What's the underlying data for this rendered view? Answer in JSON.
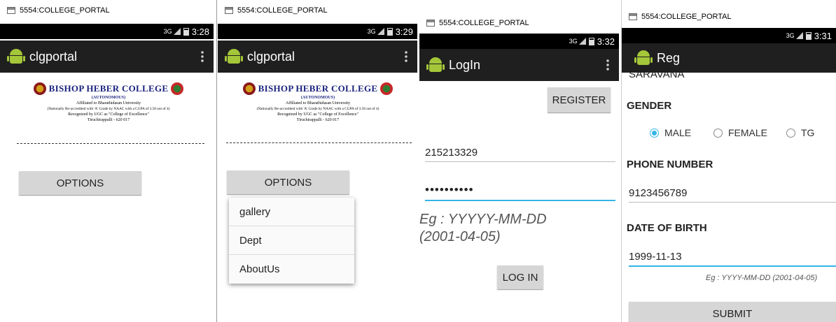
{
  "screens": [
    {
      "window_title": "5554:COLLEGE_PORTAL",
      "network": "3G",
      "time": "3:28",
      "app_title": "clgportal",
      "header": {
        "college_name": "BISHOP HEBER COLLEGE",
        "autonomous": "(AUTONOMOUS)",
        "affiliation": "Affiliated to Bharathidasan University",
        "accreditation": "(Nationally Re-accredited with 'A' Grade by NAAC with a CGPA of 3.58 out of 4)",
        "recognition": "Recognized by UGC as \"College of Excellence\"",
        "address": "Tiruchirappalli - 620 017"
      },
      "options_button": "OPTIONS"
    },
    {
      "window_title": "5554:COLLEGE_PORTAL",
      "network": "3G",
      "time": "3:29",
      "app_title": "clgportal",
      "header": {
        "college_name": "BISHOP HEBER COLLEGE",
        "autonomous": "(AUTONOMOUS)",
        "affiliation": "Affiliated to Bharathidasan University",
        "accreditation": "(Nationally Re-accredited with 'A' Grade by NAAC with a CGPA of 3.58 out of 4)",
        "recognition": "Recognized by UGC as \"College of Excellence\"",
        "address": "Tiruchirappalli - 620 017"
      },
      "options_button": "OPTIONS",
      "menu": [
        "gallery",
        "Dept",
        "AboutUs"
      ]
    },
    {
      "window_title": "5554:COLLEGE_PORTAL",
      "network": "3G",
      "time": "3:32",
      "app_title": "LogIn",
      "register_button": "REGISTER",
      "username_value": "215213329",
      "password_value": "••••••••••",
      "date_hint": "Eg : YYYYY-MM-DD (2001-04-05)",
      "login_button": "LOG IN"
    },
    {
      "window_title": "5554:COLLEGE_PORTAL",
      "network": "3G",
      "time": "3:31",
      "app_title": "Reg",
      "name_value": "SARAVANA",
      "gender_label": "GENDER",
      "gender_options": [
        "MALE",
        "FEMALE",
        "TG"
      ],
      "gender_selected": "MALE",
      "phone_label": "PHONE NUMBER",
      "phone_value": "9123456789",
      "dob_label": "DATE OF BIRTH",
      "dob_value": "1999-11-13",
      "dob_hint": "Eg : YYYY-MM-DD (2001-04-05)",
      "submit_button": "SUBMIT"
    }
  ]
}
